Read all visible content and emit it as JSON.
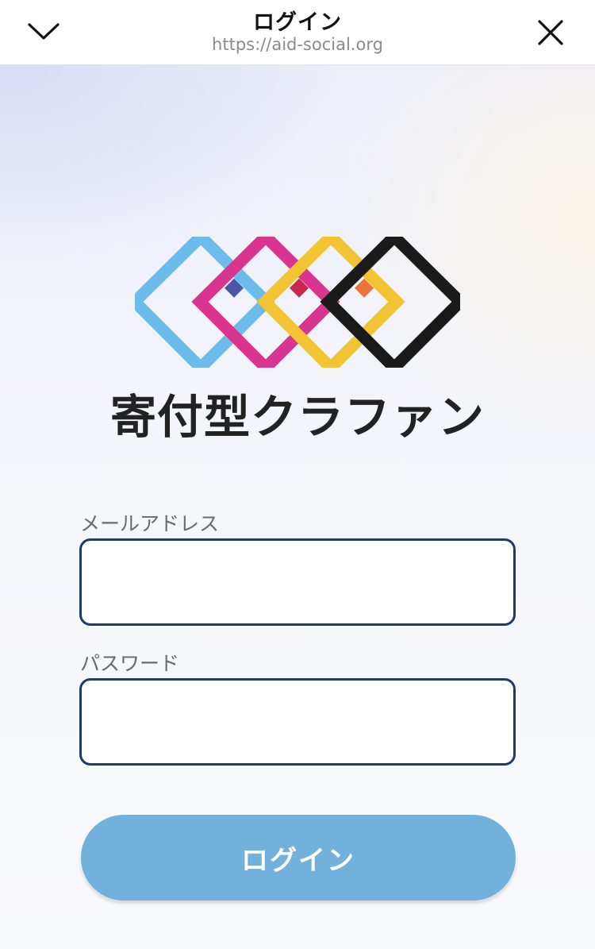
{
  "header": {
    "title": "ログイン",
    "url": "https://aid-social.org",
    "collapse_icon": "chevron-down-icon",
    "close_icon": "close-icon"
  },
  "brand": {
    "name": "寄付型クラファン",
    "logo_colors": [
      "#6bbcea",
      "#d9348f",
      "#f2c332",
      "#1a1a1a"
    ]
  },
  "form": {
    "email_label": "メールアドレス",
    "email_value": "",
    "password_label": "パスワード",
    "password_value": "",
    "submit_label": "ログイン",
    "submit_color": "#71b1db"
  }
}
